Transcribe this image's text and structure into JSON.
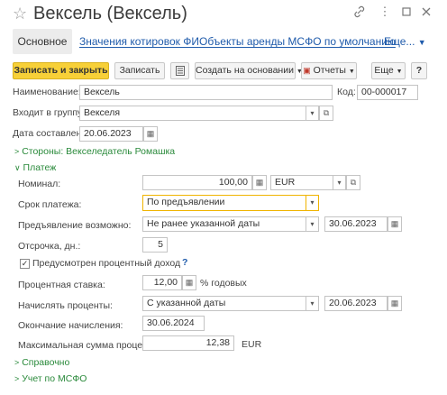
{
  "window": {
    "title": "Вексель (Вексель)"
  },
  "tabs": {
    "main": "Основное",
    "quotes": "Значения котировок ФИ",
    "lease": "Объекты аренды МСФО по умолчанию",
    "more": "Еще..."
  },
  "toolbar": {
    "save_close": "Записать и закрыть",
    "save": "Записать",
    "create_based": "Создать на основании",
    "reports": "Отчеты",
    "more": "Еще",
    "help": "?"
  },
  "form": {
    "name_label": "Наименование:",
    "name_value": "Вексель",
    "code_label": "Код:",
    "code_value": "00-000017",
    "group_label": "Входит в группу:",
    "group_value": "Векселя",
    "date_label": "Дата составления:",
    "date_value": "20.06.2023"
  },
  "sections": {
    "parties": "Стороны: Векселедатель Ромашка",
    "payment": "Платеж",
    "reference": "Справочно",
    "ifrs": "Учет по МСФО"
  },
  "payment": {
    "nominal_label": "Номинал:",
    "nominal_value": "100,00",
    "currency_value": "EUR",
    "term_label": "Срок платежа:",
    "term_value": "По предъявлении",
    "presentation_label": "Предъявление возможно:",
    "presentation_value": "Не ранее указанной даты",
    "presentation_date": "30.06.2023",
    "deferral_label": "Отсрочка, дн.:",
    "deferral_value": "5",
    "interest_check_label": "Предусмотрен процентный доход",
    "interest_help": "?",
    "rate_label": "Процентная ставка:",
    "rate_value": "12,00",
    "rate_unit": "% годовых",
    "accrue_label": "Начислять проценты:",
    "accrue_value": "С указанной даты",
    "accrue_date": "20.06.2023",
    "end_label": "Окончание начисления:",
    "end_value": "30.06.2024",
    "max_label": "Максимальная сумма процентов:",
    "max_value": "12,38",
    "max_currency": "EUR"
  }
}
